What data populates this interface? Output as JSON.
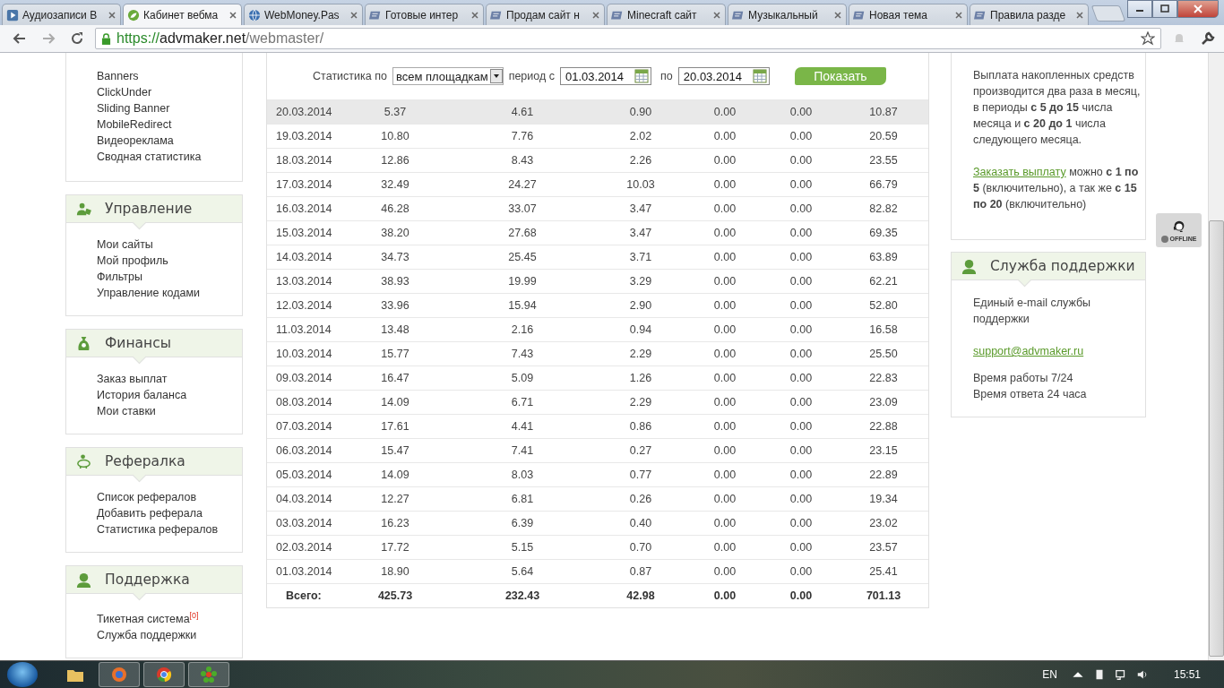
{
  "browser": {
    "tabs": [
      {
        "title": "Аудиозаписи В",
        "kind": "audio",
        "selected": false
      },
      {
        "title": "Кабинет вебма",
        "kind": "leaf",
        "selected": true
      },
      {
        "title": "WebMoney.Pas",
        "kind": "globe",
        "selected": false
      },
      {
        "title": "Готовые интер",
        "kind": "forum",
        "selected": false
      },
      {
        "title": "Продам сайт н",
        "kind": "forum",
        "selected": false
      },
      {
        "title": "Minecraft сайт",
        "kind": "forum",
        "selected": false
      },
      {
        "title": "Музыкальный",
        "kind": "forum",
        "selected": false
      },
      {
        "title": "Новая тема",
        "kind": "forum",
        "selected": false
      },
      {
        "title": "Правила разде",
        "kind": "forum",
        "selected": false
      }
    ],
    "url": {
      "scheme": "https://",
      "host": "advmaker.net",
      "path": "/webmaster/"
    }
  },
  "sidebar": [
    {
      "items": [
        {
          "label": "Banners"
        },
        {
          "label": "ClickUnder"
        },
        {
          "label": "Sliding Banner"
        },
        {
          "label": "MobileRedirect"
        },
        {
          "label": "Видеореклама"
        },
        {
          "label": "Сводная статистика"
        }
      ]
    },
    {
      "title": "Управление",
      "kind": "people",
      "items": [
        {
          "label": "Мои сайты"
        },
        {
          "label": "Мой профиль"
        },
        {
          "label": "Фильтры"
        },
        {
          "label": "Управление кодами"
        }
      ]
    },
    {
      "title": "Финансы",
      "kind": "money",
      "items": [
        {
          "label": "Заказ выплат"
        },
        {
          "label": "История баланса"
        },
        {
          "label": "Мои ставки"
        }
      ]
    },
    {
      "title": "Рефералка",
      "kind": "piggy",
      "items": [
        {
          "label": "Список рефералов"
        },
        {
          "label": "Добавить реферала"
        },
        {
          "label": "Статистика рефералов"
        }
      ]
    },
    {
      "title": "Поддержка",
      "kind": "person",
      "items": [
        {
          "label": "Тикетная система",
          "badge": "[0]"
        },
        {
          "label": "Служба поддержки"
        }
      ]
    }
  ],
  "filter": {
    "label": "Статистика по",
    "scope": "всем площадкам",
    "from_label": "период с",
    "date_from": "01.03.2014",
    "to_label": "по",
    "date_to": "20.03.2014",
    "button": "Показать"
  },
  "table": {
    "rows": [
      {
        "date": "20.03.2014",
        "values": [
          "5.37",
          "4.61",
          "0.90",
          "0.00",
          "0.00",
          "10.87"
        ],
        "highlighted": true
      },
      {
        "date": "19.03.2014",
        "values": [
          "10.80",
          "7.76",
          "2.02",
          "0.00",
          "0.00",
          "20.59"
        ],
        "highlighted": false
      },
      {
        "date": "18.03.2014",
        "values": [
          "12.86",
          "8.43",
          "2.26",
          "0.00",
          "0.00",
          "23.55"
        ],
        "highlighted": false
      },
      {
        "date": "17.03.2014",
        "values": [
          "32.49",
          "24.27",
          "10.03",
          "0.00",
          "0.00",
          "66.79"
        ],
        "highlighted": false
      },
      {
        "date": "16.03.2014",
        "values": [
          "46.28",
          "33.07",
          "3.47",
          "0.00",
          "0.00",
          "82.82"
        ],
        "highlighted": false
      },
      {
        "date": "15.03.2014",
        "values": [
          "38.20",
          "27.68",
          "3.47",
          "0.00",
          "0.00",
          "69.35"
        ],
        "highlighted": false
      },
      {
        "date": "14.03.2014",
        "values": [
          "34.73",
          "25.45",
          "3.71",
          "0.00",
          "0.00",
          "63.89"
        ],
        "highlighted": false
      },
      {
        "date": "13.03.2014",
        "values": [
          "38.93",
          "19.99",
          "3.29",
          "0.00",
          "0.00",
          "62.21"
        ],
        "highlighted": false
      },
      {
        "date": "12.03.2014",
        "values": [
          "33.96",
          "15.94",
          "2.90",
          "0.00",
          "0.00",
          "52.80"
        ],
        "highlighted": false
      },
      {
        "date": "11.03.2014",
        "values": [
          "13.48",
          "2.16",
          "0.94",
          "0.00",
          "0.00",
          "16.58"
        ],
        "highlighted": false
      },
      {
        "date": "10.03.2014",
        "values": [
          "15.77",
          "7.43",
          "2.29",
          "0.00",
          "0.00",
          "25.50"
        ],
        "highlighted": false
      },
      {
        "date": "09.03.2014",
        "values": [
          "16.47",
          "5.09",
          "1.26",
          "0.00",
          "0.00",
          "22.83"
        ],
        "highlighted": false
      },
      {
        "date": "08.03.2014",
        "values": [
          "14.09",
          "6.71",
          "2.29",
          "0.00",
          "0.00",
          "23.09"
        ],
        "highlighted": false
      },
      {
        "date": "07.03.2014",
        "values": [
          "17.61",
          "4.41",
          "0.86",
          "0.00",
          "0.00",
          "22.88"
        ],
        "highlighted": false
      },
      {
        "date": "06.03.2014",
        "values": [
          "15.47",
          "7.41",
          "0.27",
          "0.00",
          "0.00",
          "23.15"
        ],
        "highlighted": false
      },
      {
        "date": "05.03.2014",
        "values": [
          "14.09",
          "8.03",
          "0.77",
          "0.00",
          "0.00",
          "22.89"
        ],
        "highlighted": false
      },
      {
        "date": "04.03.2014",
        "values": [
          "12.27",
          "6.81",
          "0.26",
          "0.00",
          "0.00",
          "19.34"
        ],
        "highlighted": false
      },
      {
        "date": "03.03.2014",
        "values": [
          "16.23",
          "6.39",
          "0.40",
          "0.00",
          "0.00",
          "23.02"
        ],
        "highlighted": false
      },
      {
        "date": "02.03.2014",
        "values": [
          "17.72",
          "5.15",
          "0.70",
          "0.00",
          "0.00",
          "23.57"
        ],
        "highlighted": false
      },
      {
        "date": "01.03.2014",
        "values": [
          "18.90",
          "5.64",
          "0.87",
          "0.00",
          "0.00",
          "25.41"
        ],
        "highlighted": false
      }
    ],
    "total": {
      "label": "Всего:",
      "values": [
        "425.73",
        "232.43",
        "42.98",
        "0.00",
        "0.00",
        "701.13"
      ]
    }
  },
  "payout": {
    "text": "Выплата накопленных средств производится два раза в месяц, в периоды **с 5 до 15** числа месяца и **с 20 до 1** числа следующего месяца.",
    "link": "Заказать выплату",
    "link_rest": " можно **с 1 по 5** (включительно), а так же **с 15 по 20** (включительно)"
  },
  "support": {
    "title": "Служба поддержки",
    "text": "Единый e-mail службы поддержки",
    "email": "support@advmaker.ru",
    "lines": [
      "Время работы 7/24",
      "Время ответа 24 часа"
    ]
  },
  "chat": {
    "status": "OFFLINE",
    "online": false
  },
  "taskbar": {
    "apps": [
      {
        "kind": "folder"
      },
      {
        "kind": "firefox"
      },
      {
        "kind": "chrome"
      },
      {
        "kind": "icq"
      }
    ],
    "language": "EN",
    "clock": "15:51"
  }
}
